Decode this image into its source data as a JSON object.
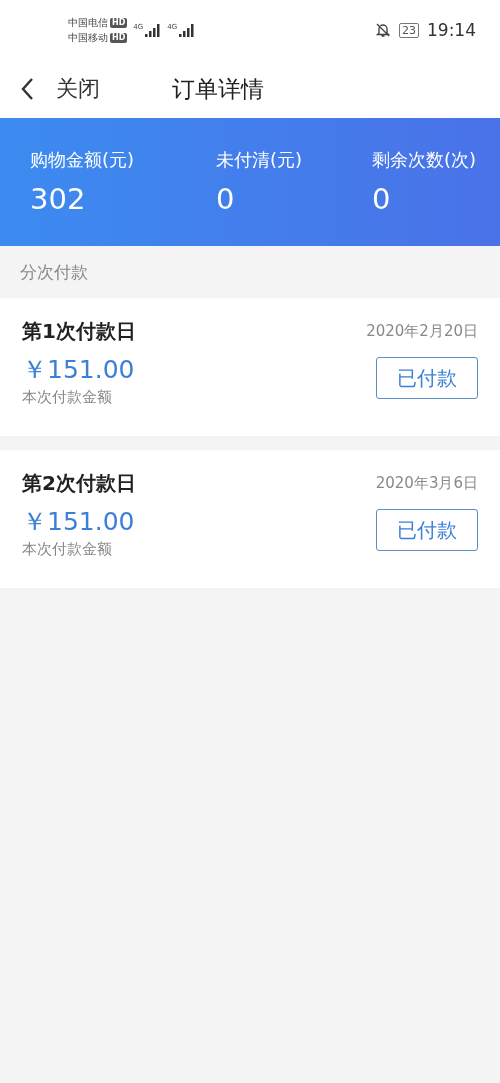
{
  "status_bar": {
    "carriers": [
      {
        "name": "中国电信",
        "badge": "HD"
      },
      {
        "name": "中国移动",
        "badge": "HD"
      }
    ],
    "network_labels": [
      "4G",
      "4G"
    ],
    "battery": "23",
    "time": "19:14"
  },
  "nav": {
    "back_label": "关闭",
    "title": "订单详情"
  },
  "summary": [
    {
      "label": "购物金额(元)",
      "value": "302"
    },
    {
      "label": "未付清(元)",
      "value": "0"
    },
    {
      "label": "剩余次数(次)",
      "value": "0"
    }
  ],
  "section_label": "分次付款",
  "payments": [
    {
      "title": "第1次付款日",
      "date": "2020年2月20日",
      "amount": "￥151.00",
      "amount_label": "本次付款金额",
      "status": "已付款"
    },
    {
      "title": "第2次付款日",
      "date": "2020年3月6日",
      "amount": "￥151.00",
      "amount_label": "本次付款金额",
      "status": "已付款"
    }
  ]
}
